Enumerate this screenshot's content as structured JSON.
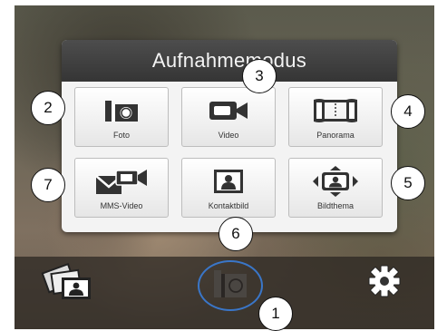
{
  "panel": {
    "title": "Aufnahmemodus",
    "tiles": [
      {
        "label": "Foto",
        "icon": "camera-icon"
      },
      {
        "label": "Video",
        "icon": "video-camera-icon"
      },
      {
        "label": "Panorama",
        "icon": "panorama-icon"
      },
      {
        "label": "MMS-Video",
        "icon": "mms-video-icon"
      },
      {
        "label": "Kontaktbild",
        "icon": "contact-picture-icon"
      },
      {
        "label": "Bildthema",
        "icon": "subject-frame-icon"
      }
    ]
  },
  "bottom_bar": {
    "gallery_icon": "gallery-icon",
    "shutter_icon": "camera-shutter-icon",
    "settings_icon": "gear-icon"
  },
  "callouts": [
    "1",
    "2",
    "3",
    "4",
    "5",
    "6",
    "7"
  ],
  "colors": {
    "panel_header": "#3f3f3f",
    "shutter_ring": "#3a76c8",
    "icon_dark": "#333333"
  }
}
